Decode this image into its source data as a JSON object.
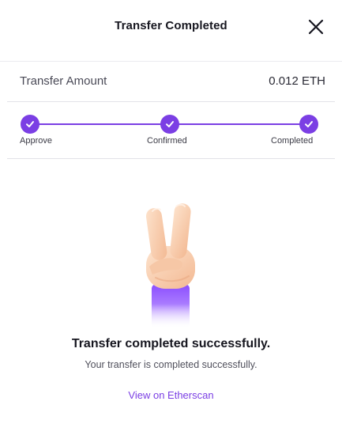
{
  "header": {
    "title": "Transfer Completed",
    "close_icon": "close-icon"
  },
  "transfer": {
    "amount_label": "Transfer Amount",
    "amount_value": "0.012 ETH"
  },
  "stepper": {
    "steps": [
      {
        "label": "Approve",
        "status": "done"
      },
      {
        "label": "Confirmed",
        "status": "done"
      },
      {
        "label": "Completed",
        "status": "done"
      }
    ]
  },
  "result": {
    "illustration": "victory-hand-icon",
    "title": "Transfer completed successfully.",
    "subtitle": "Your transfer is completed successfully.",
    "link_label": "View on Etherscan"
  },
  "colors": {
    "accent": "#7b3fe4",
    "text_primary": "#16161f",
    "divider": "#e2e2e8"
  }
}
